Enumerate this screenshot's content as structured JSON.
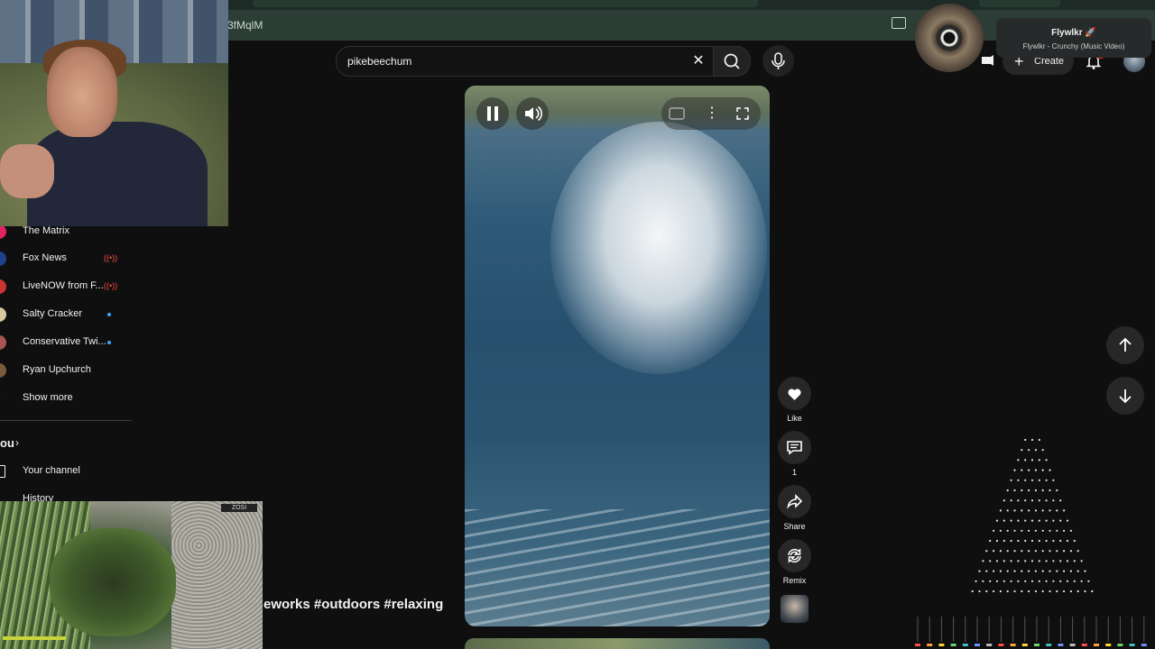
{
  "browser": {
    "url_fragment": "3fMqlM"
  },
  "sidebar": {
    "subscriptions": [
      {
        "label": "The Matrix",
        "avatar_color": "#e0245e",
        "indicator": "none"
      },
      {
        "label": "Fox News",
        "avatar_color": "#1f3f8f",
        "indicator": "live"
      },
      {
        "label": "LiveNOW from F...",
        "avatar_color": "#c33",
        "indicator": "live"
      },
      {
        "label": "Salty Cracker",
        "avatar_color": "#d9c9a0",
        "indicator": "dot"
      },
      {
        "label": "Conservative Twi...",
        "avatar_color": "#a55",
        "indicator": "dot"
      },
      {
        "label": "Ryan Upchurch",
        "avatar_color": "#7a5a3a",
        "indicator": "none"
      }
    ],
    "show_more": "Show more",
    "you_heading": "ou",
    "your_channel": "Your channel",
    "history": "History"
  },
  "search": {
    "value": "pikebeechum"
  },
  "header": {
    "create_label": "Create"
  },
  "now_playing": {
    "artist": "Flywlkr 🚀",
    "track": "Flywlkr - Crunchy (Music Video)"
  },
  "garden_cam": {
    "badge": "ZOSI"
  },
  "short": {
    "caption": "eworks #outdoors #relaxing",
    "like_label": "Like",
    "comment_count": "1",
    "share_label": "Share",
    "remix_label": "Remix"
  },
  "colors": {
    "background": "#0f0f0f",
    "accent_live": "#ff4e45",
    "accent_dot": "#3ea6ff"
  }
}
